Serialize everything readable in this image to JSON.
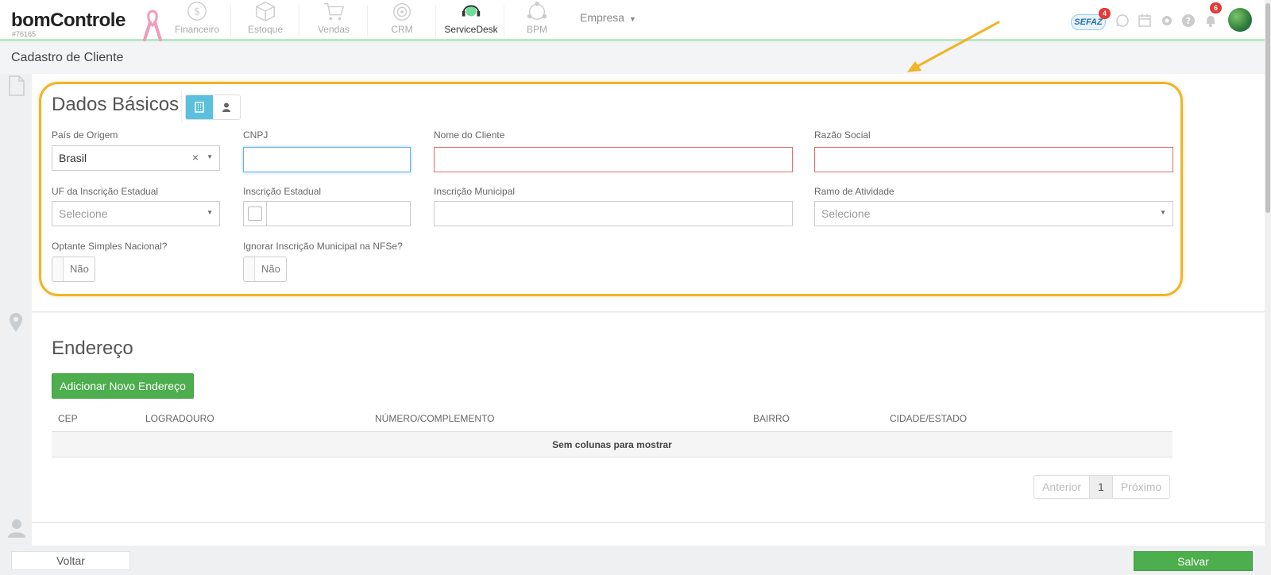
{
  "app": {
    "logo": "bomControle",
    "account_id": "#76165"
  },
  "nav": [
    {
      "label": "Financeiro",
      "icon": "dollar-icon"
    },
    {
      "label": "Estoque",
      "icon": "box-icon"
    },
    {
      "label": "Vendas",
      "icon": "cart-icon"
    },
    {
      "label": "CRM",
      "icon": "target-icon"
    },
    {
      "label": "ServiceDesk",
      "icon": "headset-icon"
    },
    {
      "label": "BPM",
      "icon": "network-icon"
    }
  ],
  "company_menu": {
    "label": "Empresa"
  },
  "topbar": {
    "sefaz_label": "SEFAZ",
    "sefaz_badge": "4",
    "notifications_badge": "6"
  },
  "page": {
    "title": "Cadastro de Cliente"
  },
  "basic": {
    "title": "Dados Básicos",
    "labels": {
      "pais": "País de Origem",
      "cnpj": "CNPJ",
      "nome": "Nome do Cliente",
      "razao": "Razão Social",
      "uf": "UF da Inscrição Estadual",
      "ie": "Inscrição Estadual",
      "im": "Inscrição Municipal",
      "ramo": "Ramo de Atividade",
      "simples": "Optante Simples Nacional?",
      "ignorar": "Ignorar Inscrição Municipal na NFSe?"
    },
    "values": {
      "pais": "Brasil",
      "cnpj": "",
      "nome": "",
      "razao": "",
      "ie": "",
      "im": ""
    },
    "placeholders": {
      "uf": "Selecione",
      "ramo": "Selecione"
    },
    "switches": {
      "simples": "Não",
      "ignorar": "Não"
    }
  },
  "address": {
    "title": "Endereço",
    "add_button": "Adicionar Novo Endereço",
    "columns": [
      "CEP",
      "LOGRADOURO",
      "NÚMERO/COMPLEMENTO",
      "BAIRRO",
      "CIDADE/ESTADO"
    ],
    "empty": "Sem colunas para mostrar",
    "pager": {
      "prev": "Anterior",
      "page": "1",
      "next": "Próximo"
    }
  },
  "footer": {
    "back": "Voltar",
    "save": "Salvar"
  },
  "colors": {
    "accent": "#5bc0de",
    "success": "#4cae4c",
    "highlight": "#f0b428",
    "error": "#e06c6c"
  }
}
